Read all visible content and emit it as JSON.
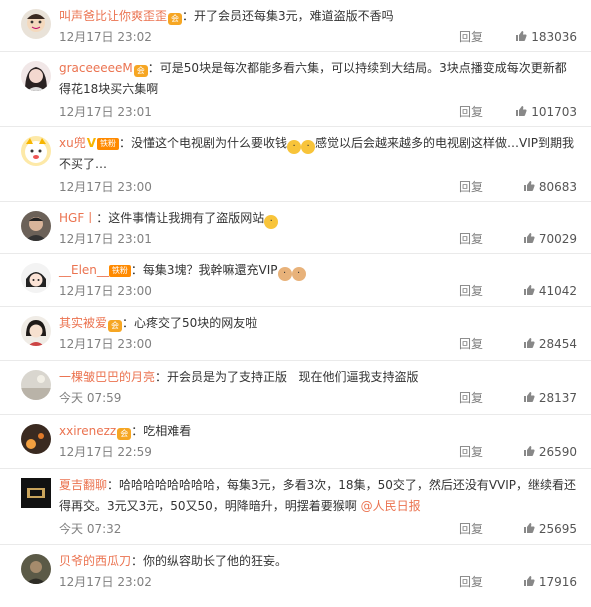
{
  "actions": {
    "reply": "回复"
  },
  "comments": [
    {
      "user": "叫声爸比让你爽歪歪",
      "badge": "会",
      "sep": "：",
      "text": "开了会员还每集3元，难道盗版不香吗",
      "time": "12月17日 23:02",
      "likes": "183036"
    },
    {
      "user": "graceeeeeM",
      "badge": "会",
      "sep": "：",
      "text": "可是50块是每次都能多看六集，可以持续到大结局。3块点播变成每次更新都得花18块买六集啊",
      "time": "12月17日 23:01",
      "likes": "101703"
    },
    {
      "user": "xu兜",
      "v": "V",
      "fan": "铁粉",
      "sep": "：",
      "text": "没懂这个电视剧为什么要收钱",
      "text2": "感觉以后会越来越多的电视剧这样做…VIP到期我不买了…",
      "time": "12月17日 23:00",
      "likes": "80683"
    },
    {
      "user": "HGF丨",
      "sep": "：",
      "text": "这件事情让我拥有了盗版网站",
      "time": "12月17日 23:01",
      "likes": "70029"
    },
    {
      "user": "__Elen__",
      "fan": "铁粉",
      "sep": "：",
      "text": "每集3塊？我幹嘛還充VIP",
      "time": "12月17日 23:00",
      "likes": "41042"
    },
    {
      "user": "其实被爱",
      "badge": "会",
      "sep": "：",
      "text": "心疼交了50块的网友啦",
      "time": "12月17日 23:00",
      "likes": "28454"
    },
    {
      "user": "一棵皱巴巴的月亮",
      "sep": "：",
      "text": "开会员是为了支持正版   现在他们逼我支持盗版",
      "time": "今天 07:59",
      "likes": "28137"
    },
    {
      "user": "xxirenezz",
      "badge": "会",
      "sep": "：",
      "text": "吃相难看",
      "time": "12月17日 22:59",
      "likes": "26590"
    },
    {
      "user": "夏吉翻聊",
      "sep": "：",
      "text": "哈哈哈哈哈哈哈哈，每集3元，多看3次，18集，50交了，然后还没有VVIP，继续看还得再交。3元又3元，50又50，明降暗升，明摆着要猴啊 ",
      "link": "@人民日报",
      "time": "今天 07:32",
      "likes": "25695"
    },
    {
      "user": "贝爷的西瓜刀",
      "sep": "：",
      "text": "你的纵容助长了他的狂妄。",
      "time": "12月17日 23:02",
      "likes": "17916"
    }
  ]
}
